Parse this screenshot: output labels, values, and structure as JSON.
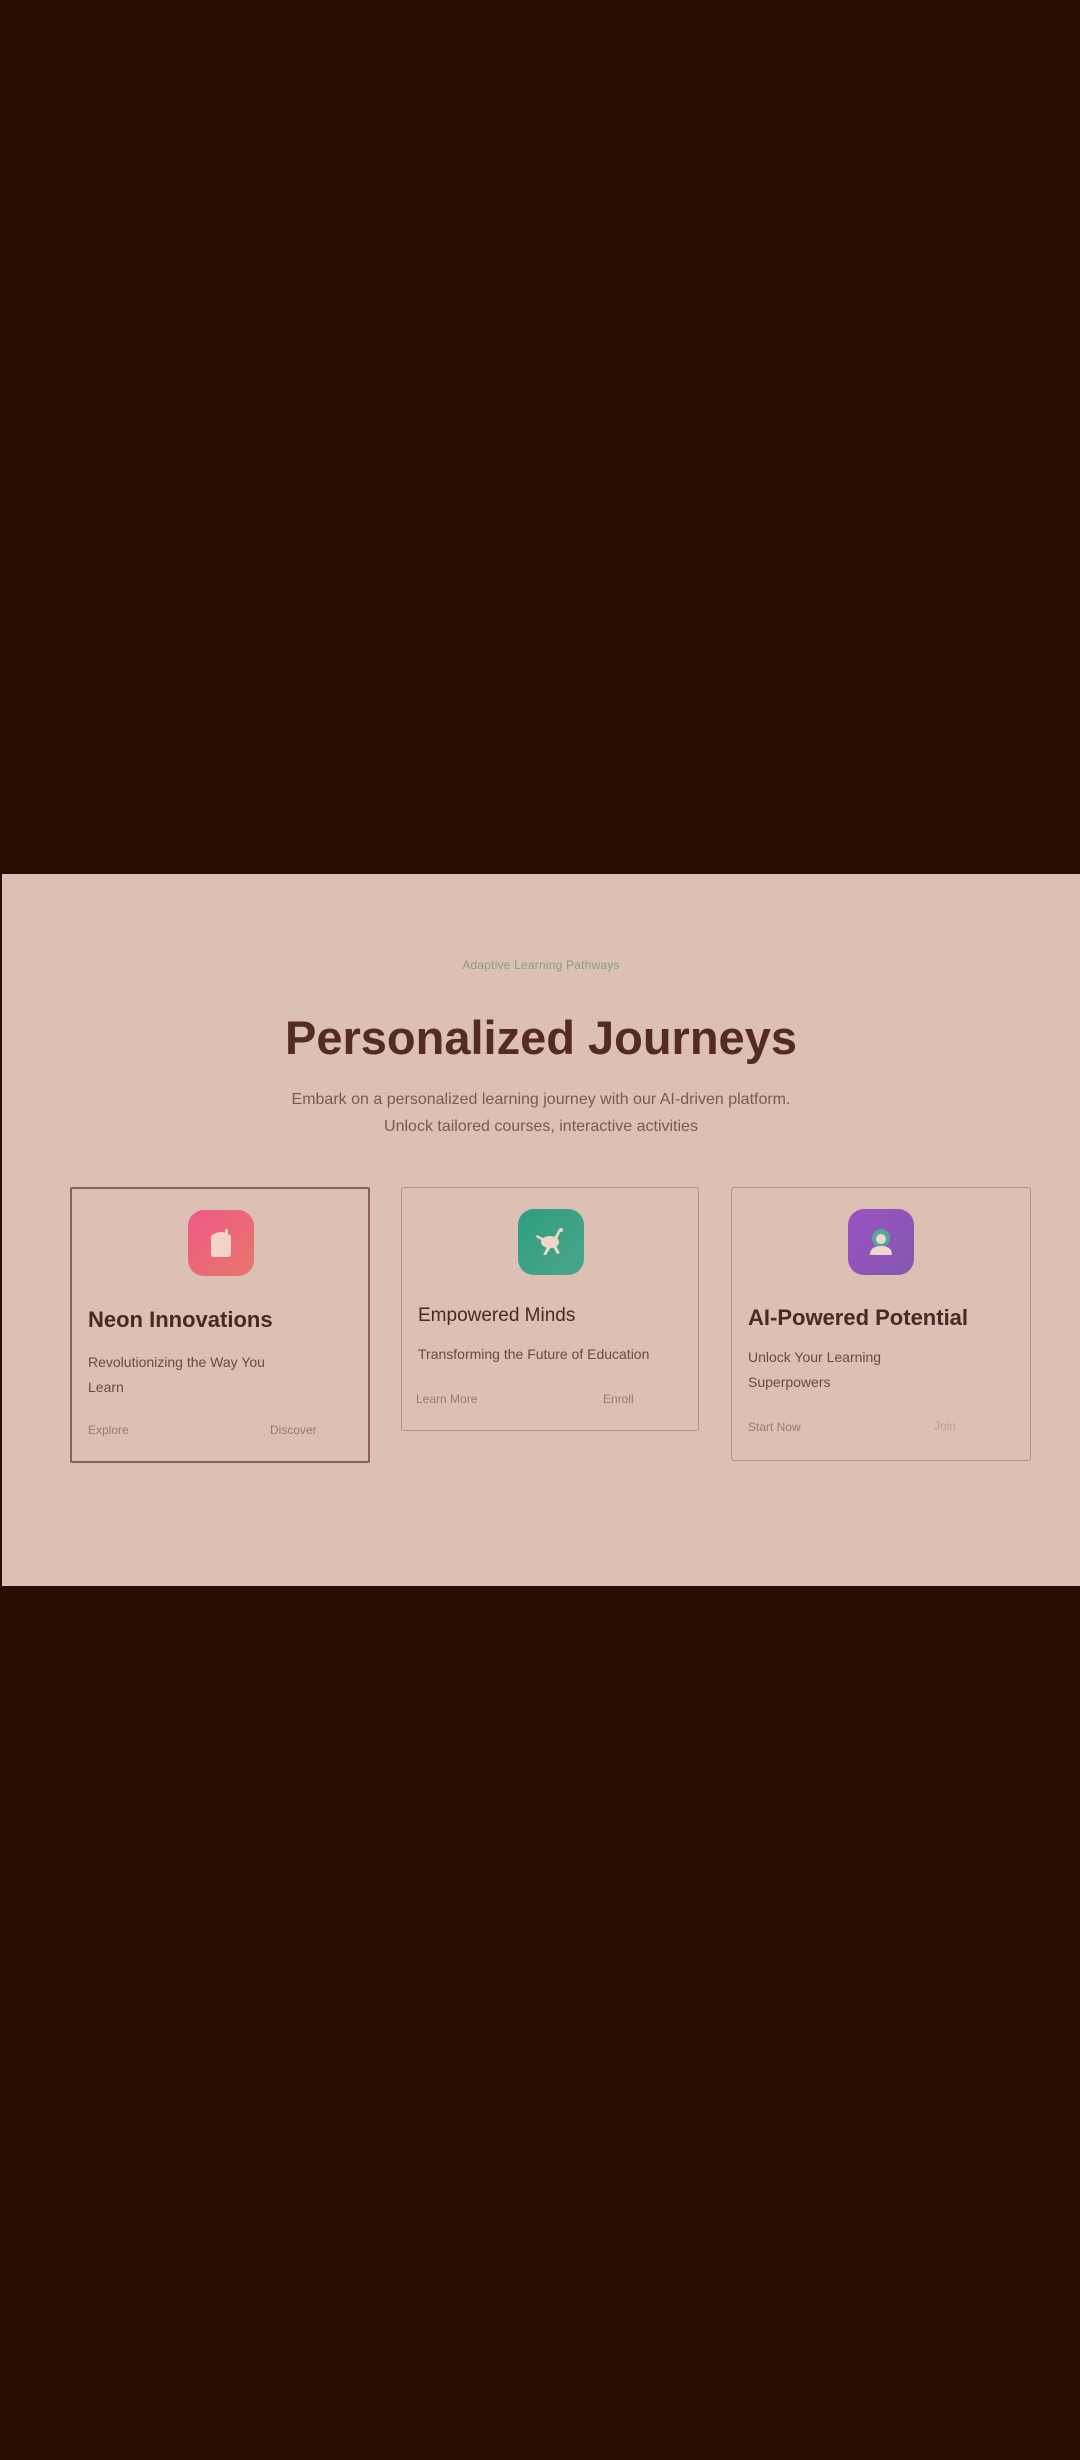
{
  "colors": {
    "page_background": "#260c03",
    "section_background": "#dcc0b3",
    "heading": "#532a24",
    "eyebrow": "#86a07a"
  },
  "section": {
    "eyebrow": "Adaptive Learning Pathways",
    "title": "Personalized Journeys",
    "subtitle_line1": "Embark on a personalized learning journey with our AI-driven platform.",
    "subtitle_line2": "Unlock tailored courses, interactive activities"
  },
  "cards": [
    {
      "icon": "gift-box-icon",
      "icon_color": "#e0607c",
      "title": "Neon Innovations",
      "description_line1": "Revolutionizing the Way You",
      "description_line2": "Learn",
      "links": [
        "Explore",
        "Discover"
      ]
    },
    {
      "icon": "running-figure-icon",
      "icon_color": "#3e9a80",
      "title": "Empowered Minds",
      "description_line1": "Transforming the Future of Education",
      "links": [
        "Learn More",
        "Enroll"
      ]
    },
    {
      "icon": "person-avatar-icon",
      "icon_color": "#8e55b0",
      "title": "AI-Powered Potential",
      "description_line1": "Unlock Your Learning",
      "description_line2": "Superpowers",
      "links": [
        "Start Now",
        "Join"
      ]
    }
  ]
}
